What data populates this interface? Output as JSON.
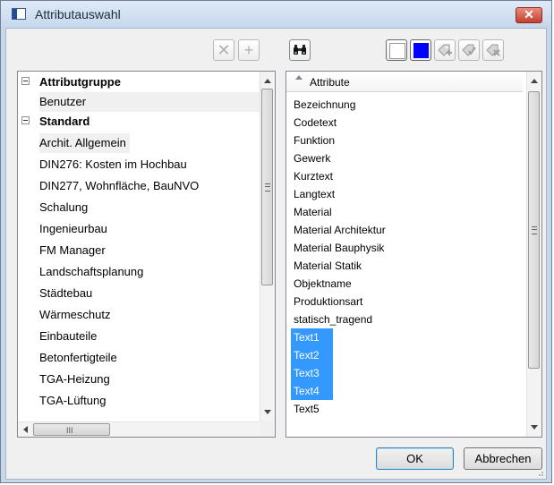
{
  "window": {
    "title": "Attributauswahl",
    "close_label": "✕"
  },
  "toolbar": {
    "delete_icon": "✕",
    "add_icon": "+",
    "find_icon": "binoculars-icon",
    "white_color": "#ffffff",
    "blue_color": "#0000ff"
  },
  "left_panel": {
    "groups": [
      {
        "label": "Attributgruppe",
        "items": [
          "Benutzer"
        ]
      },
      {
        "label": "Standard",
        "items": [
          "Archit. Allgemein",
          "DIN276: Kosten im Hochbau",
          "DIN277, Wohnfläche, BauNVO",
          "Schalung",
          "Ingenieurbau",
          "FM Manager",
          "Landschaftsplanung",
          "Städtebau",
          "Wärmeschutz",
          "Einbauteile",
          "Betonfertigteile",
          "TGA-Heizung",
          "TGA-Lüftung"
        ]
      }
    ],
    "hscroll_grip": "III"
  },
  "right_panel": {
    "header": "Attribute",
    "items": [
      "Bezeichnung",
      "Codetext",
      "Funktion",
      "Gewerk",
      "Kurztext",
      "Langtext",
      "Material",
      "Material Architektur",
      "Material Bauphysik",
      "Material Statik",
      "Objektname",
      "Produktionsart",
      "statisch_tragend",
      "Text1",
      "Text2",
      "Text3",
      "Text4",
      "Text5"
    ],
    "selected": [
      "Text1",
      "Text2",
      "Text3",
      "Text4"
    ]
  },
  "buttons": {
    "ok": "OK",
    "cancel": "Abbrechen"
  }
}
